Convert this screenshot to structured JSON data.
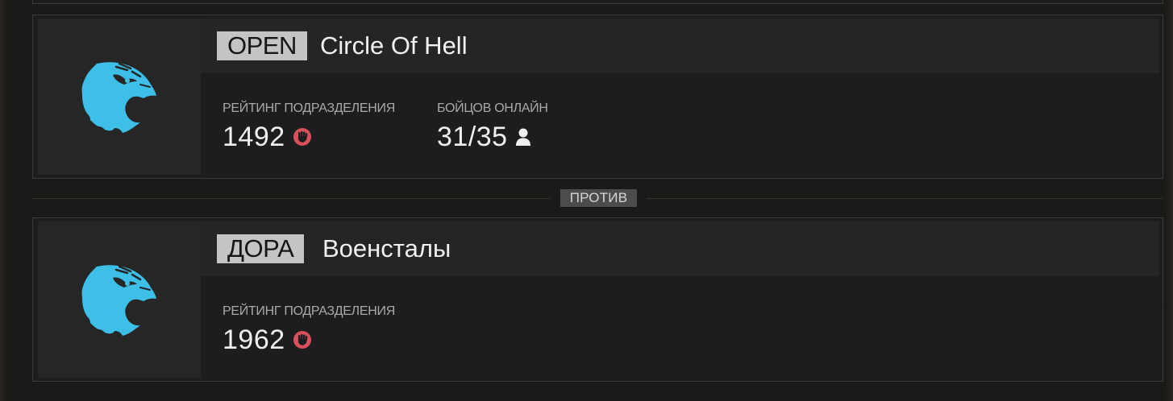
{
  "matchup": {
    "versus_label": "ПРОТИВ"
  },
  "teams": [
    {
      "tag": "OPEN",
      "name": "Circle Of Hell",
      "emblem_icon": "eagle-icon",
      "emblem_color": "#3dbfe8",
      "rating": {
        "label": "РЕЙТИНГ ПОДРАЗДЕЛЕНИЯ",
        "value": "1492",
        "icon": "fist-icon",
        "icon_color": "#d9505a"
      },
      "online": {
        "label": "БОЙЦОВ ОНЛАЙН",
        "value": "31/35",
        "icon": "person-icon"
      }
    },
    {
      "tag": "ДОРА",
      "name": "Военсталы",
      "emblem_icon": "eagle-icon",
      "emblem_color": "#3dbfe8",
      "rating": {
        "label": "РЕЙТИНГ ПОДРАЗДЕЛЕНИЯ",
        "value": "1962",
        "icon": "fist-icon",
        "icon_color": "#d9505a"
      }
    }
  ]
}
